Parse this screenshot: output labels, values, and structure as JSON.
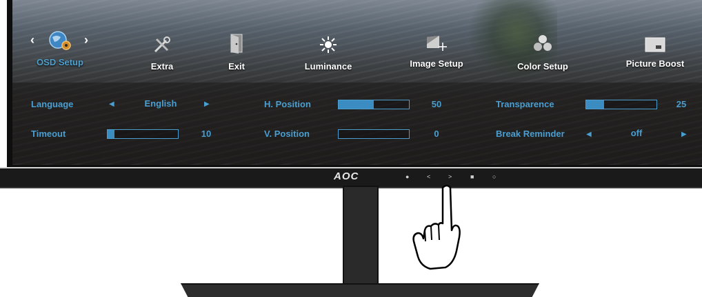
{
  "menu": {
    "tabs": [
      {
        "label": "OSD Setup",
        "icon": "globe-gear-icon",
        "active": true
      },
      {
        "label": "Extra",
        "icon": "tools-icon"
      },
      {
        "label": "Exit",
        "icon": "door-icon"
      },
      {
        "label": "Luminance",
        "icon": "sun-icon"
      },
      {
        "label": "Image Setup",
        "icon": "image-move-icon"
      },
      {
        "label": "Color Setup",
        "icon": "color-circles-icon"
      },
      {
        "label": "Picture Boost",
        "icon": "picture-icon"
      }
    ]
  },
  "settings": {
    "language": {
      "label": "Language",
      "value": "English"
    },
    "timeout": {
      "label": "Timeout",
      "value": "10",
      "level": 10
    },
    "h_position": {
      "label": "H. Position",
      "value": "50",
      "level": 50
    },
    "v_position": {
      "label": "V. Position",
      "value": "0",
      "level": 0
    },
    "transparence": {
      "label": "Transparence",
      "value": "25",
      "level": 25
    },
    "break_reminder": {
      "label": "Break Reminder",
      "value": "off"
    }
  },
  "bezel": {
    "brand": "AOC"
  },
  "colors": {
    "accent": "#4a9fd0",
    "bar_fill": "#3b8cc0"
  }
}
